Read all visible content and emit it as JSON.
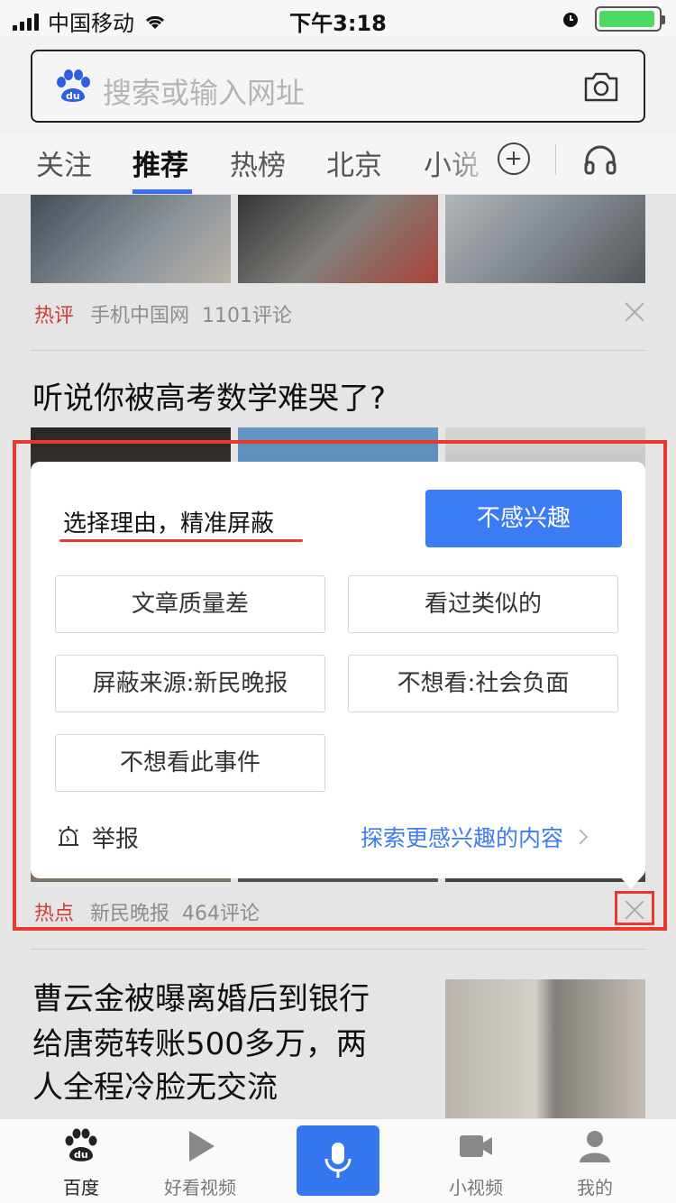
{
  "status_bar": {
    "carrier": "中国移动",
    "time": "下午3:18",
    "battery_level": 0.95
  },
  "search": {
    "placeholder": "搜索或输入网址",
    "logo_icon": "baidu-paw-icon",
    "camera_icon": "camera-icon"
  },
  "tabs": {
    "items": [
      "关注",
      "推荐",
      "热榜",
      "北京",
      "小说"
    ],
    "active_index": 1,
    "plus_icon": "plus-circle-icon",
    "audio_icon": "headphone-icon"
  },
  "feed": {
    "item1": {
      "tag": "热评",
      "source": "手机中国网",
      "comments": "1101评论"
    },
    "item2": {
      "title": "听说你被高考数学难哭了?",
      "tag": "热点",
      "source": "新民晚报",
      "comments": "464评论"
    },
    "item3": {
      "title_line1": "曹云金被曝离婚后到银行",
      "title_line2": "给唐菀转账500多万，两",
      "title_line3": "人全程冷脸无交流"
    }
  },
  "dislike_popup": {
    "title": "选择理由，精准屏蔽",
    "primary_button": "不感兴趣",
    "reasons": [
      "文章质量差",
      "看过类似的",
      "屏蔽来源:新民晚报",
      "不想看:社会负面",
      "不想看此事件"
    ],
    "report_label": "举报",
    "explore_label": "探索更感兴趣的内容"
  },
  "bottom_nav": {
    "items": [
      {
        "label": "百度",
        "icon": "baidu-paw-icon"
      },
      {
        "label": "好看视频",
        "icon": "play-icon"
      },
      {
        "label": "",
        "icon": "microphone-icon"
      },
      {
        "label": "小视频",
        "icon": "video-camera-icon"
      },
      {
        "label": "我的",
        "icon": "person-icon"
      }
    ],
    "active_index": 0
  },
  "colors": {
    "accent_blue": "#3b7cf6",
    "hot_red": "#e0443a",
    "annotation_red": "#e53a2e",
    "link_blue": "#3c7cf4"
  }
}
